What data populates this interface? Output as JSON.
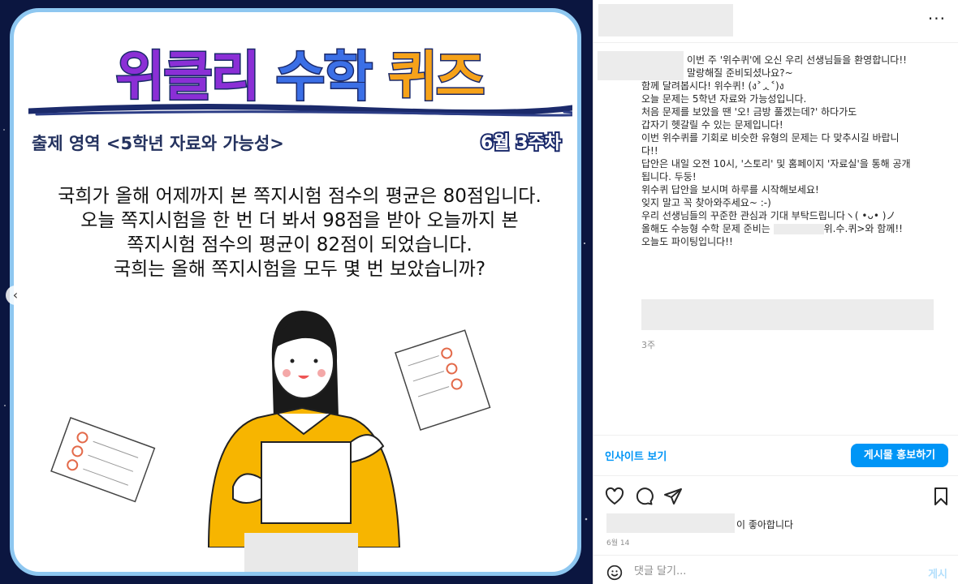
{
  "post_image": {
    "title_parts": [
      "위클리",
      "수학",
      "퀴즈"
    ],
    "area": "출제 영역 <5학년 자료와 가능성>",
    "week": "6월 3주차",
    "question_lines": [
      "국희가 올해 어제까지 본 쪽지시험 점수의 평균은 80점입니다.",
      "오늘 쪽지시험을 한 번 더 봐서 98점을 받아 오늘까지 본",
      "쪽지시험 점수의 평균이 82점이 되었습니다.",
      "국희는 올해 쪽지시험을 모두 몇 번 보았습니까?"
    ],
    "nav_prev": "‹"
  },
  "header": {
    "more": "···"
  },
  "caption": {
    "lines": [
      "이번 주 '위수퀴'에 오신 우리 선생님들을 환영합니다!!",
      "말랑해질 준비되셨나요?~",
      "함께 달려봅시다! 위수퀴! (ง˃ᆺ˂)ง",
      "",
      "오늘 문제는 5학년 자료와 가능성입니다.",
      "처음 문제를 보았을 땐 '오! 금방 풀겠는데?' 하다가도",
      "갑자기 헷갈릴 수 있는 문제입니다!",
      "이번 위수퀴를 기회로 비슷한 유형의 문제는 다 맞추시길 바랍니",
      "다!!",
      "",
      "답안은 내일 오전 10시, '스토리' 및 홈페이지 '자료실'을 통해 공개",
      "됩니다. 두둥!",
      "위수퀴 답안을 보시며 하루를 시작해보세요!",
      "잊지 말고 꼭 찾아와주세요~ :-)",
      "",
      "우리 선생님들의 꾸준한 관심과 기대 부탁드립니다ヽ( •ᴗ• )ノ",
      "올해도 수능형 수학 문제 준비는",
      "오늘도 파이팅입니다!!"
    ],
    "line16_suffix": "위.수.퀴>와 함께!!",
    "age": "3주"
  },
  "actions": {
    "insight": "인사이트 보기",
    "promote": "게시물 홍보하기",
    "likes_suffix": "이 좋아합니다",
    "date": "6월 14"
  },
  "comment": {
    "placeholder": "댓글 달기...",
    "post_label": "게시"
  },
  "colors": {
    "accent_blue": "#0095f6",
    "card_border": "#8ec7f0",
    "title_purple": "#8b2fd6",
    "title_blue": "#3b6fe6",
    "title_orange": "#f6a219",
    "shirt_yellow": "#f7b500"
  },
  "icons": [
    "heart-icon",
    "comment-icon",
    "share-icon",
    "bookmark-icon",
    "emoji-icon",
    "more-icon"
  ]
}
